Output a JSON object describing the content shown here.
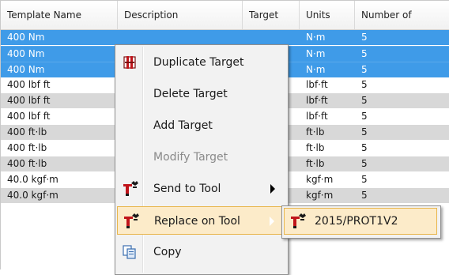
{
  "table": {
    "columns": [
      "Template Name",
      "Description",
      "Target",
      "Units",
      "Number of"
    ],
    "rows": [
      {
        "name": "400 Nm",
        "description": "",
        "target": "",
        "units": "N·m",
        "number": "5",
        "selected": true
      },
      {
        "name": "400 Nm",
        "description": "",
        "target": "",
        "units": "N·m",
        "number": "5",
        "selected": true
      },
      {
        "name": "400 Nm",
        "description": "",
        "target": "",
        "units": "N·m",
        "number": "5",
        "selected": true
      },
      {
        "name": "400 lbf ft",
        "description": "",
        "target": "",
        "units": "lbf·ft",
        "number": "5",
        "selected": false
      },
      {
        "name": "400 lbf ft",
        "description": "",
        "target": "",
        "units": "lbf·ft",
        "number": "5",
        "selected": false
      },
      {
        "name": "400 lbf ft",
        "description": "",
        "target": "",
        "units": "lbf·ft",
        "number": "5",
        "selected": false
      },
      {
        "name": "400 ft·lb",
        "description": "",
        "target": "",
        "units": "ft·lb",
        "number": "5",
        "selected": false
      },
      {
        "name": "400 ft·lb",
        "description": "",
        "target": "",
        "units": "ft·lb",
        "number": "5",
        "selected": false
      },
      {
        "name": "400 ft·lb",
        "description": "",
        "target": "",
        "units": "ft·lb",
        "number": "5",
        "selected": false
      },
      {
        "name": "40.0 kgf·m",
        "description": "",
        "target": "",
        "units": "kgf·m",
        "number": "5",
        "selected": false
      },
      {
        "name": "40.0 kgf·m",
        "description": "",
        "target": "",
        "units": "kgf·m",
        "number": "5",
        "selected": false
      }
    ]
  },
  "context_menu": {
    "items": [
      {
        "label": "Duplicate Target",
        "icon": "duplicate-icon",
        "enabled": true
      },
      {
        "label": "Delete Target",
        "icon": "",
        "enabled": true
      },
      {
        "label": "Add Target",
        "icon": "",
        "enabled": true
      },
      {
        "label": "Modify Target",
        "icon": "",
        "enabled": false
      },
      {
        "label": "Send to Tool",
        "icon": "wrench-tool-icon",
        "enabled": true,
        "submenu": true
      },
      {
        "label": "Replace on Tool",
        "icon": "wrench-tool-icon",
        "enabled": true,
        "submenu": true,
        "highlighted": true
      },
      {
        "label": "Copy",
        "icon": "copy-icon",
        "enabled": true
      }
    ]
  },
  "submenu": {
    "items": [
      {
        "label": "2015/PROT1V2",
        "icon": "wrench-tool-icon"
      }
    ]
  },
  "colors": {
    "selection": "#3f9be8",
    "row_alt": "#d8d8d8",
    "menu_bg": "#f2f2f2",
    "menu_hover": "#fcebc9",
    "menu_hover_border": "#e8b64c"
  }
}
